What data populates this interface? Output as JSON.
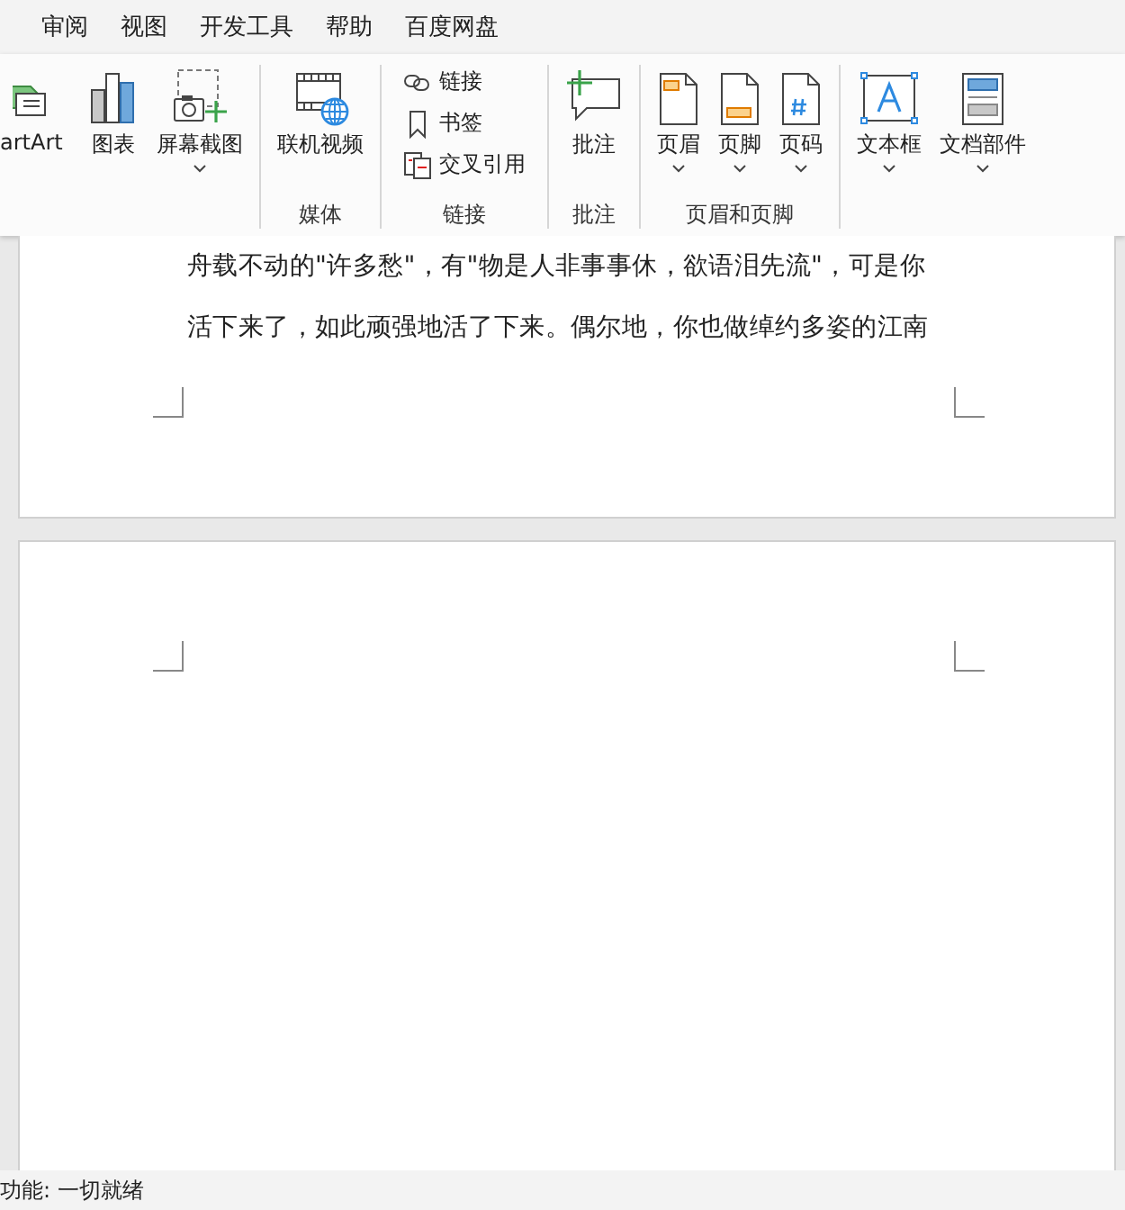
{
  "menu_tabs": [
    "审阅",
    "视图",
    "开发工具",
    "帮助",
    "百度网盘"
  ],
  "ribbon_groups": [
    {
      "controls": [
        {
          "kind": "large",
          "label": "artArt",
          "dropdown": false
        },
        {
          "kind": "large",
          "label": "图表",
          "dropdown": false
        },
        {
          "kind": "large",
          "label": "屏幕截图",
          "dropdown": true
        }
      ]
    },
    {
      "label": "媒体",
      "controls": [
        {
          "kind": "large",
          "label": "联机视频",
          "dropdown": false
        }
      ]
    },
    {
      "label": "链接",
      "controls": [
        {
          "kind": "small",
          "label": "链接"
        },
        {
          "kind": "small",
          "label": "书签"
        },
        {
          "kind": "small",
          "label": "交叉引用"
        }
      ]
    },
    {
      "label": "批注",
      "controls": [
        {
          "kind": "large",
          "label": "批注",
          "dropdown": false
        }
      ]
    },
    {
      "label": "页眉和页脚",
      "controls": [
        {
          "kind": "large",
          "label": "页眉",
          "dropdown": true
        },
        {
          "kind": "large",
          "label": "页脚",
          "dropdown": true
        },
        {
          "kind": "large",
          "label": "页码",
          "dropdown": true
        }
      ]
    },
    {
      "controls": [
        {
          "kind": "large",
          "label": "文本框",
          "dropdown": true
        },
        {
          "kind": "large",
          "label": "文档部件",
          "dropdown": true
        }
      ]
    }
  ],
  "pages": [
    {
      "kind": "text",
      "lines": [
        "舟载不动的\"许多愁\"，有\"物是人非事事休，欲语泪先流\"，可是你",
        "活下来了，如此顽强地活了下来。偶尔地，你也做绰约多姿的江南"
      ]
    },
    {
      "kind": "blank"
    }
  ],
  "status_bar": {
    "text": "功能: 一切就绪"
  }
}
